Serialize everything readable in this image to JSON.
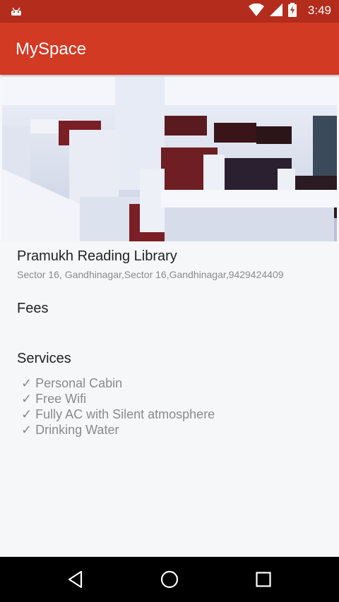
{
  "status_bar": {
    "time": "3:49"
  },
  "app_bar": {
    "title": "MySpace"
  },
  "library": {
    "name": "Pramukh Reading Library",
    "address": "Sector 16, Gandhinagar,Sector 16,Gandhinagar,9429424409"
  },
  "fees": {
    "heading": "Fees"
  },
  "services": {
    "heading": "Services",
    "items": [
      "✓ Personal Cabin",
      "✓ Free Wifi",
      "✓ Fully AC with Silent atmosphere",
      "✓ Drinking Water"
    ]
  },
  "nav_bar": {
    "buttons": [
      "back-icon",
      "home-icon",
      "recents-icon"
    ]
  }
}
